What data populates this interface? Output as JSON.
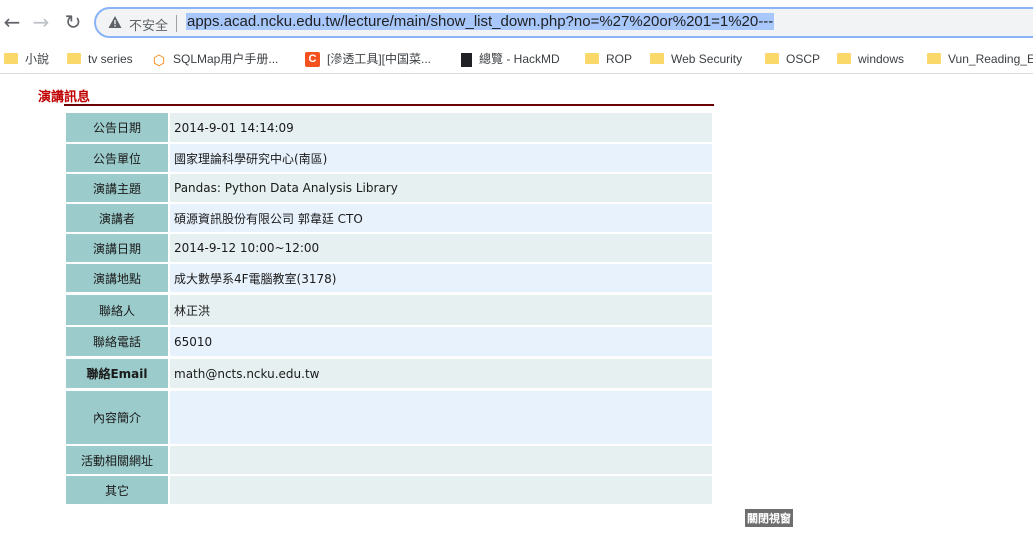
{
  "browser": {
    "security_label": "不安全",
    "url": "apps.acad.ncku.edu.tw/lecture/main/show_list_down.php?no=%27%20or%201=1%20---",
    "back_icon": "back-arrow",
    "forward_icon": "forward-arrow",
    "reload_icon": "reload"
  },
  "bookmarks": [
    {
      "label": "小說",
      "icon": "folder"
    },
    {
      "label": "tv series",
      "icon": "folder"
    },
    {
      "label": "SQLMap用户手册...",
      "icon": "sqlmap"
    },
    {
      "label": "[滲透工具][中国菜...",
      "icon": "c-logo"
    },
    {
      "label": "總覽 - HackMD",
      "icon": "document"
    },
    {
      "label": "ROP",
      "icon": "folder"
    },
    {
      "label": "Web Security",
      "icon": "folder"
    },
    {
      "label": "OSCP",
      "icon": "folder"
    },
    {
      "label": "windows",
      "icon": "folder"
    },
    {
      "label": "Vun_Reading_E",
      "icon": "folder"
    }
  ],
  "page": {
    "section_title": "演講訊息",
    "close_label": "關閉視窗"
  },
  "rows": [
    {
      "label": "公告日期",
      "value": "2014-9-01 14:14:09"
    },
    {
      "label": "公告單位",
      "value": "國家理論科學研究中心(南區)"
    },
    {
      "label": "演講主題",
      "value": "Pandas: Python Data Analysis Library"
    },
    {
      "label": "演講者",
      "value": "碩源資訊股份有限公司  郭韋廷    CTO"
    },
    {
      "label": "演講日期",
      "value": "2014-9-12 10:00~12:00"
    },
    {
      "label": "演講地點",
      "value": "成大數學系4F電腦教室(3178)"
    },
    {
      "label": "聯絡人",
      "value": "林正洪"
    },
    {
      "label": "聯絡電話",
      "value": "65010"
    },
    {
      "label": "聯絡Email",
      "value": "math@ncts.ncku.edu.tw"
    },
    {
      "label": "內容簡介",
      "value": ""
    },
    {
      "label": "活動相關網址",
      "value": ""
    },
    {
      "label": "其它",
      "value": ""
    }
  ],
  "colors": {
    "label_bg": "#9ccbcb",
    "value_bg_a": "#e6f0f0",
    "value_bg_b": "#e8f2fd",
    "title_red": "#c00000"
  }
}
